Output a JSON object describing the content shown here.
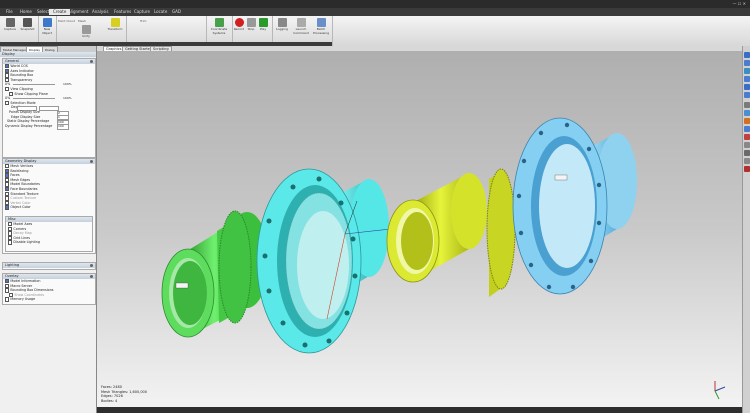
{
  "titlebar": {
    "title": "",
    "controls": "— ☐ ✕"
  },
  "menu_tabs": [
    {
      "label": "File",
      "active": false
    },
    {
      "label": "Home",
      "active": false
    },
    {
      "label": "Select",
      "active": false
    },
    {
      "label": "Create",
      "active": true
    },
    {
      "label": "Alignment",
      "active": false
    },
    {
      "label": "Analysis",
      "active": false
    },
    {
      "label": "Features",
      "active": false
    },
    {
      "label": "Capture",
      "active": false
    },
    {
      "label": "Locate",
      "active": false
    },
    {
      "label": "GAD",
      "active": false
    }
  ],
  "ribbon": {
    "capture": "Capture",
    "snapshot": "Snapshot",
    "new_object": "New Object",
    "point_cloud": "Point Cloud",
    "unify": "Unify",
    "mesh": "Mesh",
    "transform": "Transform",
    "trim": "Trim",
    "coordinate_systems": "Coordinate Systems",
    "record": "Record",
    "stop": "Stop",
    "play": "Play",
    "logging": "Logging",
    "launch": "Launch Command",
    "batch": "Batch Processing"
  },
  "panel_tabs": [
    "Model Manager",
    "Display",
    "Dialog"
  ],
  "display_panel": {
    "header": "Display",
    "general_header": "General",
    "general": [
      {
        "label": "World COS",
        "checked": true
      },
      {
        "label": "Axes Indicator",
        "checked": true
      },
      {
        "label": "Bounding Box",
        "checked": false
      },
      {
        "label": "Transparency",
        "checked": false
      }
    ],
    "transparency_value": "0%",
    "transparency_max": "100%",
    "view_clipping": "View Clipping",
    "show_clipping_plane": "Show Clipping Plane",
    "clip_value": "0%",
    "clip_max": "100%",
    "selection_mode": "Selection Mode",
    "depth_label": "Depth",
    "points_size_label": "Points Display Size",
    "points_size": "2",
    "edge_size_label": "Edge Display Size",
    "edge_size": "1",
    "static_pct_label": "Static Display Percentage",
    "static_pct": "100",
    "dynamic_pct_label": "Dynamic Display Percentage",
    "dynamic_pct": "100"
  },
  "geometry_display": {
    "header": "Geometry Display",
    "items": [
      {
        "label": "Mesh Vertices",
        "checked": false
      },
      {
        "label": "Backfacing",
        "checked": true
      },
      {
        "label": "Faces",
        "checked": true
      },
      {
        "label": "Mesh Edges",
        "checked": false
      },
      {
        "label": "Model Boundaries",
        "checked": false
      },
      {
        "label": "Face Boundaries",
        "checked": true
      },
      {
        "label": "Standard Texture",
        "checked": false
      },
      {
        "label": "Custom Texture",
        "checked": false
      },
      {
        "label": "Vertex Color",
        "checked": false
      },
      {
        "label": "Object Color",
        "checked": true
      }
    ]
  },
  "misc": {
    "header": "Misc",
    "items": [
      {
        "label": "Model Axes",
        "checked": false
      },
      {
        "label": "Corners",
        "checked": false
      },
      {
        "label": "Decay Map",
        "checked": false
      },
      {
        "label": "Grid Lines",
        "checked": false
      },
      {
        "label": "Disable Lighting",
        "checked": false
      }
    ]
  },
  "lighting_header": "Lighting",
  "overlay": {
    "header": "Overlay",
    "items": [
      {
        "label": "Model Information",
        "checked": true
      },
      {
        "label": "Macro Server",
        "checked": false
      },
      {
        "label": "Bounding Box Dimensions",
        "checked": false
      },
      {
        "label": "Show Coordinates",
        "checked": false
      },
      {
        "label": "Memory Usage",
        "checked": false
      }
    ]
  },
  "view_tabs": [
    "Graphics",
    "Getting Started",
    "Scripting"
  ],
  "stats": {
    "faces": "Faces: 2480",
    "triangles": "Mesh Triangles: 1,600,000",
    "edges": "Edges: 7026",
    "bodies": "Bodies: 4"
  },
  "colors": {
    "green": "#52e052",
    "cyan": "#55e6e6",
    "yellow": "#cddc20",
    "blue": "#79c9ee"
  }
}
